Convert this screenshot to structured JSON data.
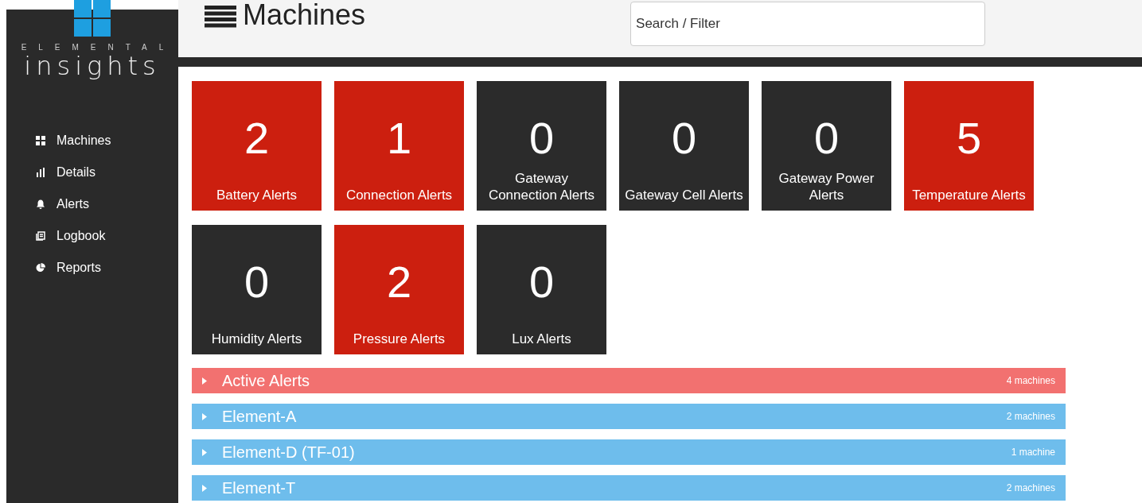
{
  "sidebar": {
    "logo": {
      "brand": "ELEMENTAL",
      "product": "insights"
    },
    "items": [
      {
        "label": "Machines"
      },
      {
        "label": "Details"
      },
      {
        "label": "Alerts"
      },
      {
        "label": "Logbook"
      },
      {
        "label": "Reports"
      }
    ]
  },
  "header": {
    "title": "Machines",
    "search": {
      "placeholder": "Search / Filter"
    }
  },
  "tiles": [
    {
      "count": "2",
      "label": "Battery Alerts",
      "color": "#cc1f0f"
    },
    {
      "count": "1",
      "label": "Connection Alerts",
      "color": "#cc1f0f"
    },
    {
      "count": "0",
      "label": "Gateway Connection Alerts",
      "color": "#2b2b2b"
    },
    {
      "count": "0",
      "label": "Gateway Cell Alerts",
      "color": "#2b2b2b"
    },
    {
      "count": "0",
      "label": "Gateway Power Alerts",
      "color": "#2b2b2b"
    },
    {
      "count": "5",
      "label": "Temperature Alerts",
      "color": "#cc1f0f"
    },
    {
      "count": "0",
      "label": "Humidity Alerts",
      "color": "#2b2b2b"
    },
    {
      "count": "2",
      "label": "Pressure Alerts",
      "color": "#cc1f0f"
    },
    {
      "count": "0",
      "label": "Lux Alerts",
      "color": "#2b2b2b"
    }
  ],
  "groups": [
    {
      "name": "Active Alerts",
      "count": "4 machines",
      "color": "#f27170",
      "expanded": false
    },
    {
      "name": "Element-A",
      "count": "2 machines",
      "color": "#6ebdec",
      "expanded": false
    },
    {
      "name": "Element-D (TF-01)",
      "count": "1 machine",
      "color": "#6ebdec",
      "expanded": false
    },
    {
      "name": "Element-T",
      "count": "2 machines",
      "color": "#6ebdec",
      "expanded": false
    }
  ]
}
